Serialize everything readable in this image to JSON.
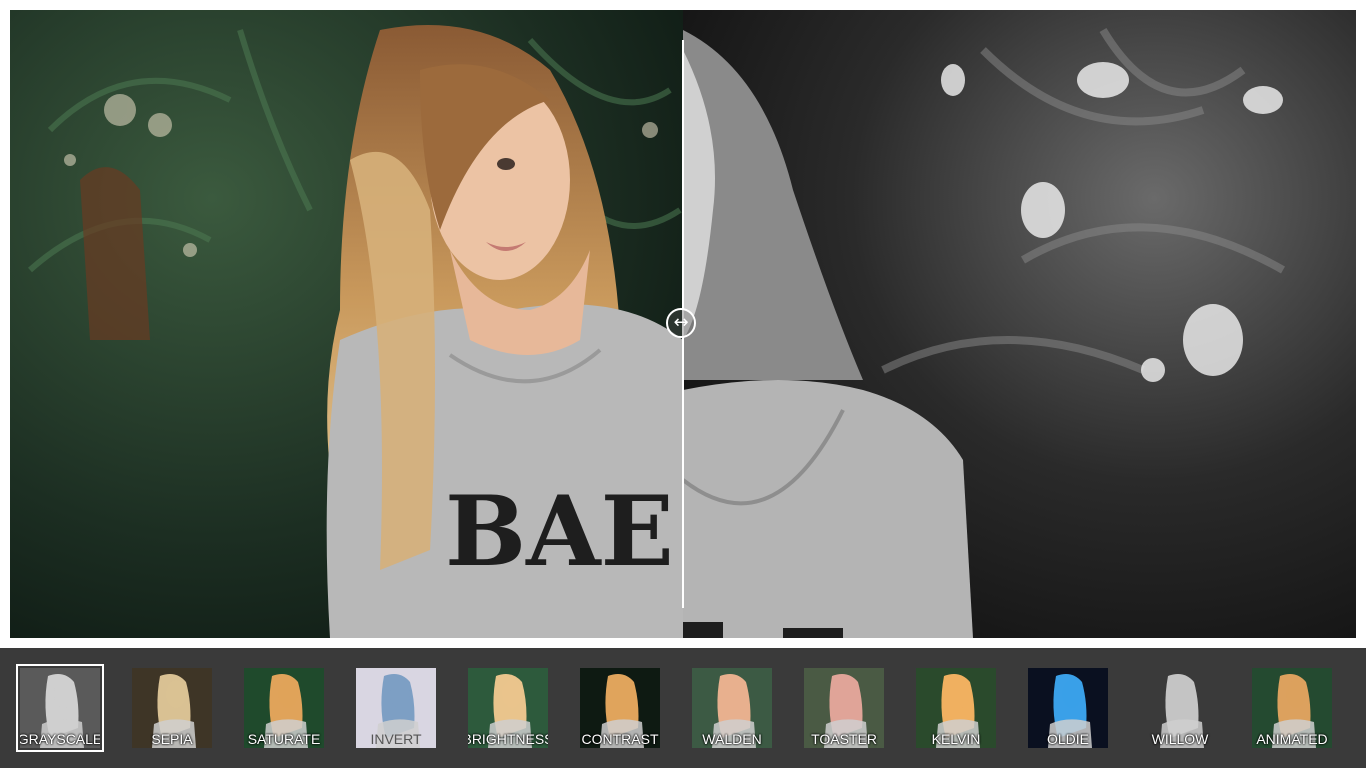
{
  "viewer": {
    "original_image": "portrait-color-photo",
    "filtered_image": "portrait-grayscale-photo",
    "handle_icon": "left-right-arrow-icon",
    "handle_glyph": "↔",
    "split_fraction": 0.5
  },
  "filters": {
    "selected": "GRAYSCALE",
    "items": [
      {
        "label": "GRAYSCALE",
        "bg": "#5a5a5a",
        "hair": "#cfcfcf"
      },
      {
        "label": "SEPIA",
        "bg": "#3e3526",
        "hair": "#d9c193"
      },
      {
        "label": "SATURATE",
        "bg": "#1f4a2c",
        "hair": "#e0a35a"
      },
      {
        "label": "INVERT",
        "bg": "#d9d6e2",
        "hair": "#7d9fc4"
      },
      {
        "label": "BRIGHTNESS",
        "bg": "#2d5a3c",
        "hair": "#e9c48c"
      },
      {
        "label": "CONTRAST",
        "bg": "#0e1a12",
        "hair": "#e0a45c"
      },
      {
        "label": "WALDEN",
        "bg": "#3c5a44",
        "hair": "#e8b08e"
      },
      {
        "label": "TOASTER",
        "bg": "#4a5a44",
        "hair": "#e0a498"
      },
      {
        "label": "KELVIN",
        "bg": "#2a4a2c",
        "hair": "#f0b060"
      },
      {
        "label": "OLDIE",
        "bg": "#0a1020",
        "hair": "#3aa0e8"
      },
      {
        "label": "WILLOW",
        "bg": "#3a3a3a",
        "hair": "#c4c4c4"
      },
      {
        "label": "ANIMATED",
        "bg": "#244a30",
        "hair": "#dca15e"
      }
    ]
  },
  "colors": {
    "strip_bg": "#3a3a3a",
    "selected_outline": "#ffffff",
    "label_text": "#ffffff"
  }
}
